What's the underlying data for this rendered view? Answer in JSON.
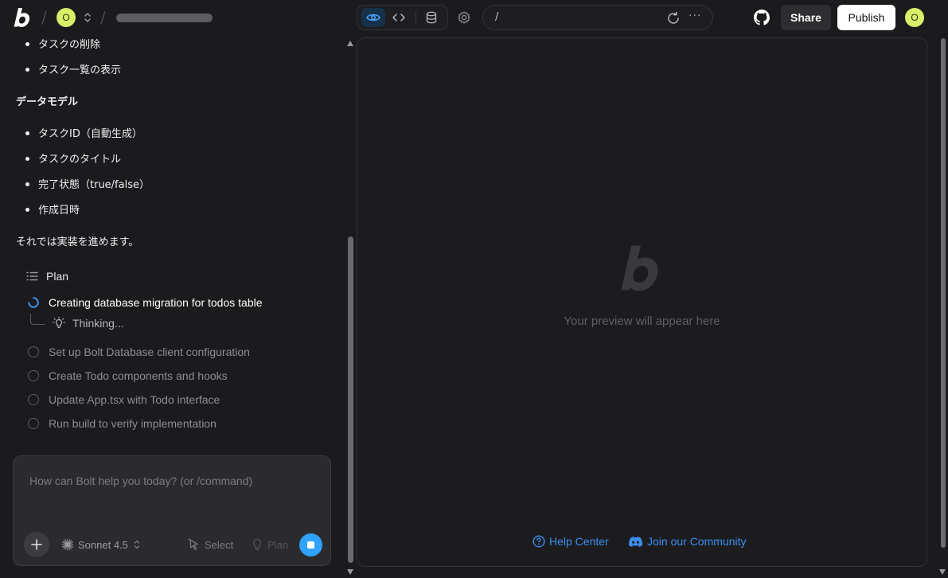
{
  "topbar": {
    "separators": [
      "/",
      "/"
    ],
    "workspace_avatar": "O",
    "user_avatar": "O",
    "url_path": "/",
    "more_glyph": "···",
    "share_label": "Share",
    "publish_label": "Publish",
    "icons": [
      "bolt-logo-icon",
      "chevron-updown-icon",
      "eye-icon",
      "code-icon",
      "database-icon",
      "settings-icon",
      "reload-icon",
      "github-icon"
    ]
  },
  "chat": {
    "features": [
      "タスクの削除",
      "タスク一覧の表示"
    ],
    "data_model_heading": "データモデル",
    "data_model": [
      "タスクID（自動生成）",
      "タスクのタイトル",
      "完了状態（true/false）",
      "作成日時"
    ],
    "closing": "それでは実装を進めます。",
    "plan_label": "Plan",
    "active_step": "Creating database migration for todos table",
    "thinking": "Thinking...",
    "pending_steps": [
      "Set up Bolt Database client configuration",
      "Create Todo components and hooks",
      "Update App.tsx with Todo interface",
      "Run build to verify implementation"
    ]
  },
  "prompt": {
    "placeholder": "How can Bolt help you today? (or /command)",
    "model": "Sonnet 4.5",
    "select_label": "Select",
    "plan_label": "Plan"
  },
  "preview": {
    "empty_message": "Your preview will appear here",
    "help_center": "Help Center",
    "community": "Join our Community"
  },
  "colors": {
    "background": "#1b1b1d",
    "accent": "#2fa2ff",
    "link": "#3c8ff0",
    "avatar": "#d9ef6a"
  }
}
